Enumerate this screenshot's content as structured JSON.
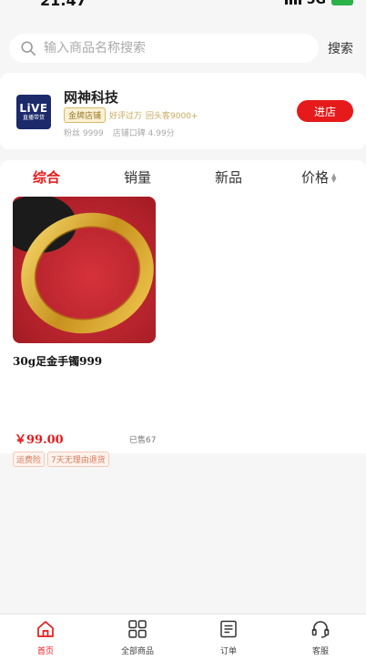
{
  "status": {
    "time": "21:47",
    "network": "5G"
  },
  "search": {
    "placeholder": "输入商品名称搜索",
    "button": "搜索"
  },
  "store": {
    "logo_line1": "LiVE",
    "logo_line2": "直播带货",
    "name": "网神科技",
    "badge": "金牌店铺",
    "tag1": "好评过万",
    "tag2": "回头客9000+",
    "fans": "粉丝 9999",
    "rating": "店铺口碑 4.99分",
    "enter_button": "进店"
  },
  "tabs": [
    {
      "label": "综合",
      "active": true
    },
    {
      "label": "销量",
      "active": false
    },
    {
      "label": "新品",
      "active": false
    },
    {
      "label": "价格",
      "active": false
    }
  ],
  "product": {
    "title": "30g足金手镯999",
    "price": "￥99.00",
    "sold": "已售67",
    "tags": [
      "运费险",
      "7天无理由退货"
    ]
  },
  "nav": [
    {
      "label": "首页",
      "icon": "home-icon",
      "active": true
    },
    {
      "label": "全部商品",
      "icon": "grid-icon",
      "active": false
    },
    {
      "label": "订单",
      "icon": "order-icon",
      "active": false
    },
    {
      "label": "客服",
      "icon": "headset-icon",
      "active": false
    }
  ],
  "colors": {
    "accent": "#e61a1a",
    "gold": "#d8b96a",
    "logo_bg": "#1c2a6b"
  }
}
